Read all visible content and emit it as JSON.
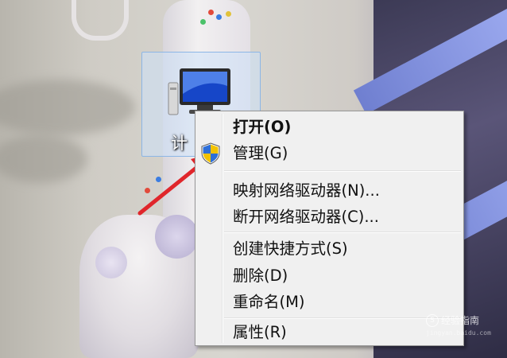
{
  "desktop": {
    "selected_icon": {
      "label": "计",
      "icon": "computer-icon"
    }
  },
  "annotation": {
    "arrow_color": "#e0262b",
    "icon": "red-arrow"
  },
  "context_menu": {
    "items": [
      {
        "label": "打开(O)",
        "bold": true
      },
      {
        "label": "管理(G)",
        "icon": "uac-shield-icon"
      },
      {
        "separator": true
      },
      {
        "label": "映射网络驱动器(N)..."
      },
      {
        "label": "断开网络驱动器(C)..."
      },
      {
        "separator": true
      },
      {
        "label": "创建快捷方式(S)"
      },
      {
        "label": "删除(D)"
      },
      {
        "label": "重命名(M)"
      },
      {
        "separator": true
      },
      {
        "label": "属性(R)"
      }
    ]
  },
  "watermark": {
    "text": "经验指南",
    "logo": "S",
    "url": "jingyan.baidu.com"
  },
  "colors": {
    "menu_background": "#f0f0f0",
    "menu_border": "#979797",
    "selection_fill": "#cde2fa",
    "selection_border": "#8cb6e6"
  }
}
